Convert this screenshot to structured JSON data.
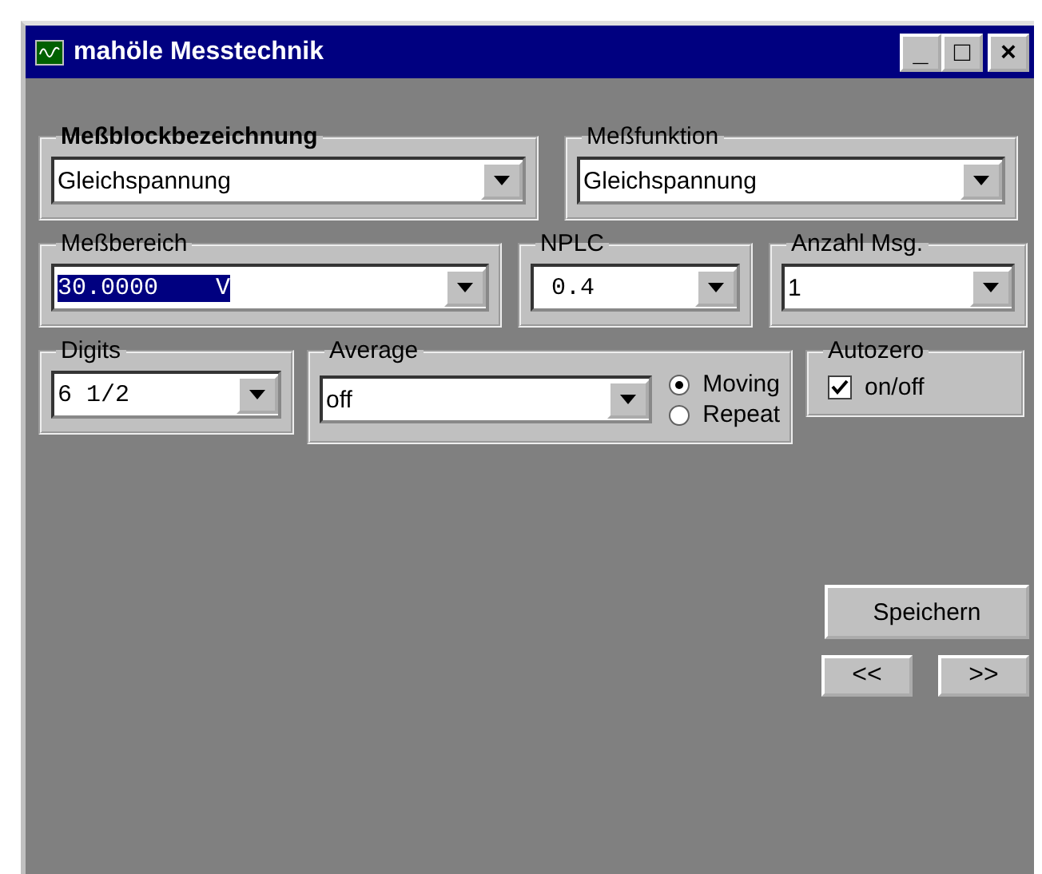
{
  "window": {
    "title": "mahöle Messtechnik",
    "controls": [
      "_",
      "□",
      "×"
    ]
  },
  "rows": [
    [
      {
        "label": "Meßblockbezeichnung",
        "bold": true,
        "combo": {
          "value": "Gleichspannung",
          "highlighted": false,
          "mono": false
        }
      },
      {
        "label": "Meßfunktion",
        "bold": false,
        "combo": {
          "value": "Gleichspannung",
          "highlighted": false,
          "mono": false
        }
      }
    ],
    [
      {
        "label": "Meßbereich",
        "bold": false,
        "combo": {
          "value": "30.0000    V",
          "highlighted": true,
          "mono": true
        }
      },
      {
        "label": "NPLC",
        "bold": false,
        "combo": {
          "value": " 0.4",
          "highlighted": false,
          "mono": true
        }
      },
      {
        "label": "Anzahl Msg.",
        "bold": false,
        "combo": {
          "value": "1",
          "highlighted": false,
          "mono": false
        }
      }
    ],
    [
      {
        "label": "Digits",
        "bold": false,
        "combo": {
          "value": "6 1/2",
          "highlighted": false,
          "mono": true
        }
      },
      {
        "label": "Average",
        "bold": false,
        "combo": {
          "value": "off",
          "highlighted": false,
          "mono": false
        },
        "radios": [
          {
            "label": "Moving",
            "selected": true
          },
          {
            "label": "Repeat",
            "selected": false
          }
        ]
      },
      {
        "label": "Autozero",
        "bold": false,
        "checkbox": {
          "label": "on/off",
          "checked": true
        }
      }
    ]
  ],
  "buttons": {
    "save": "Speichern",
    "prev": "<<",
    "next": ">>"
  }
}
